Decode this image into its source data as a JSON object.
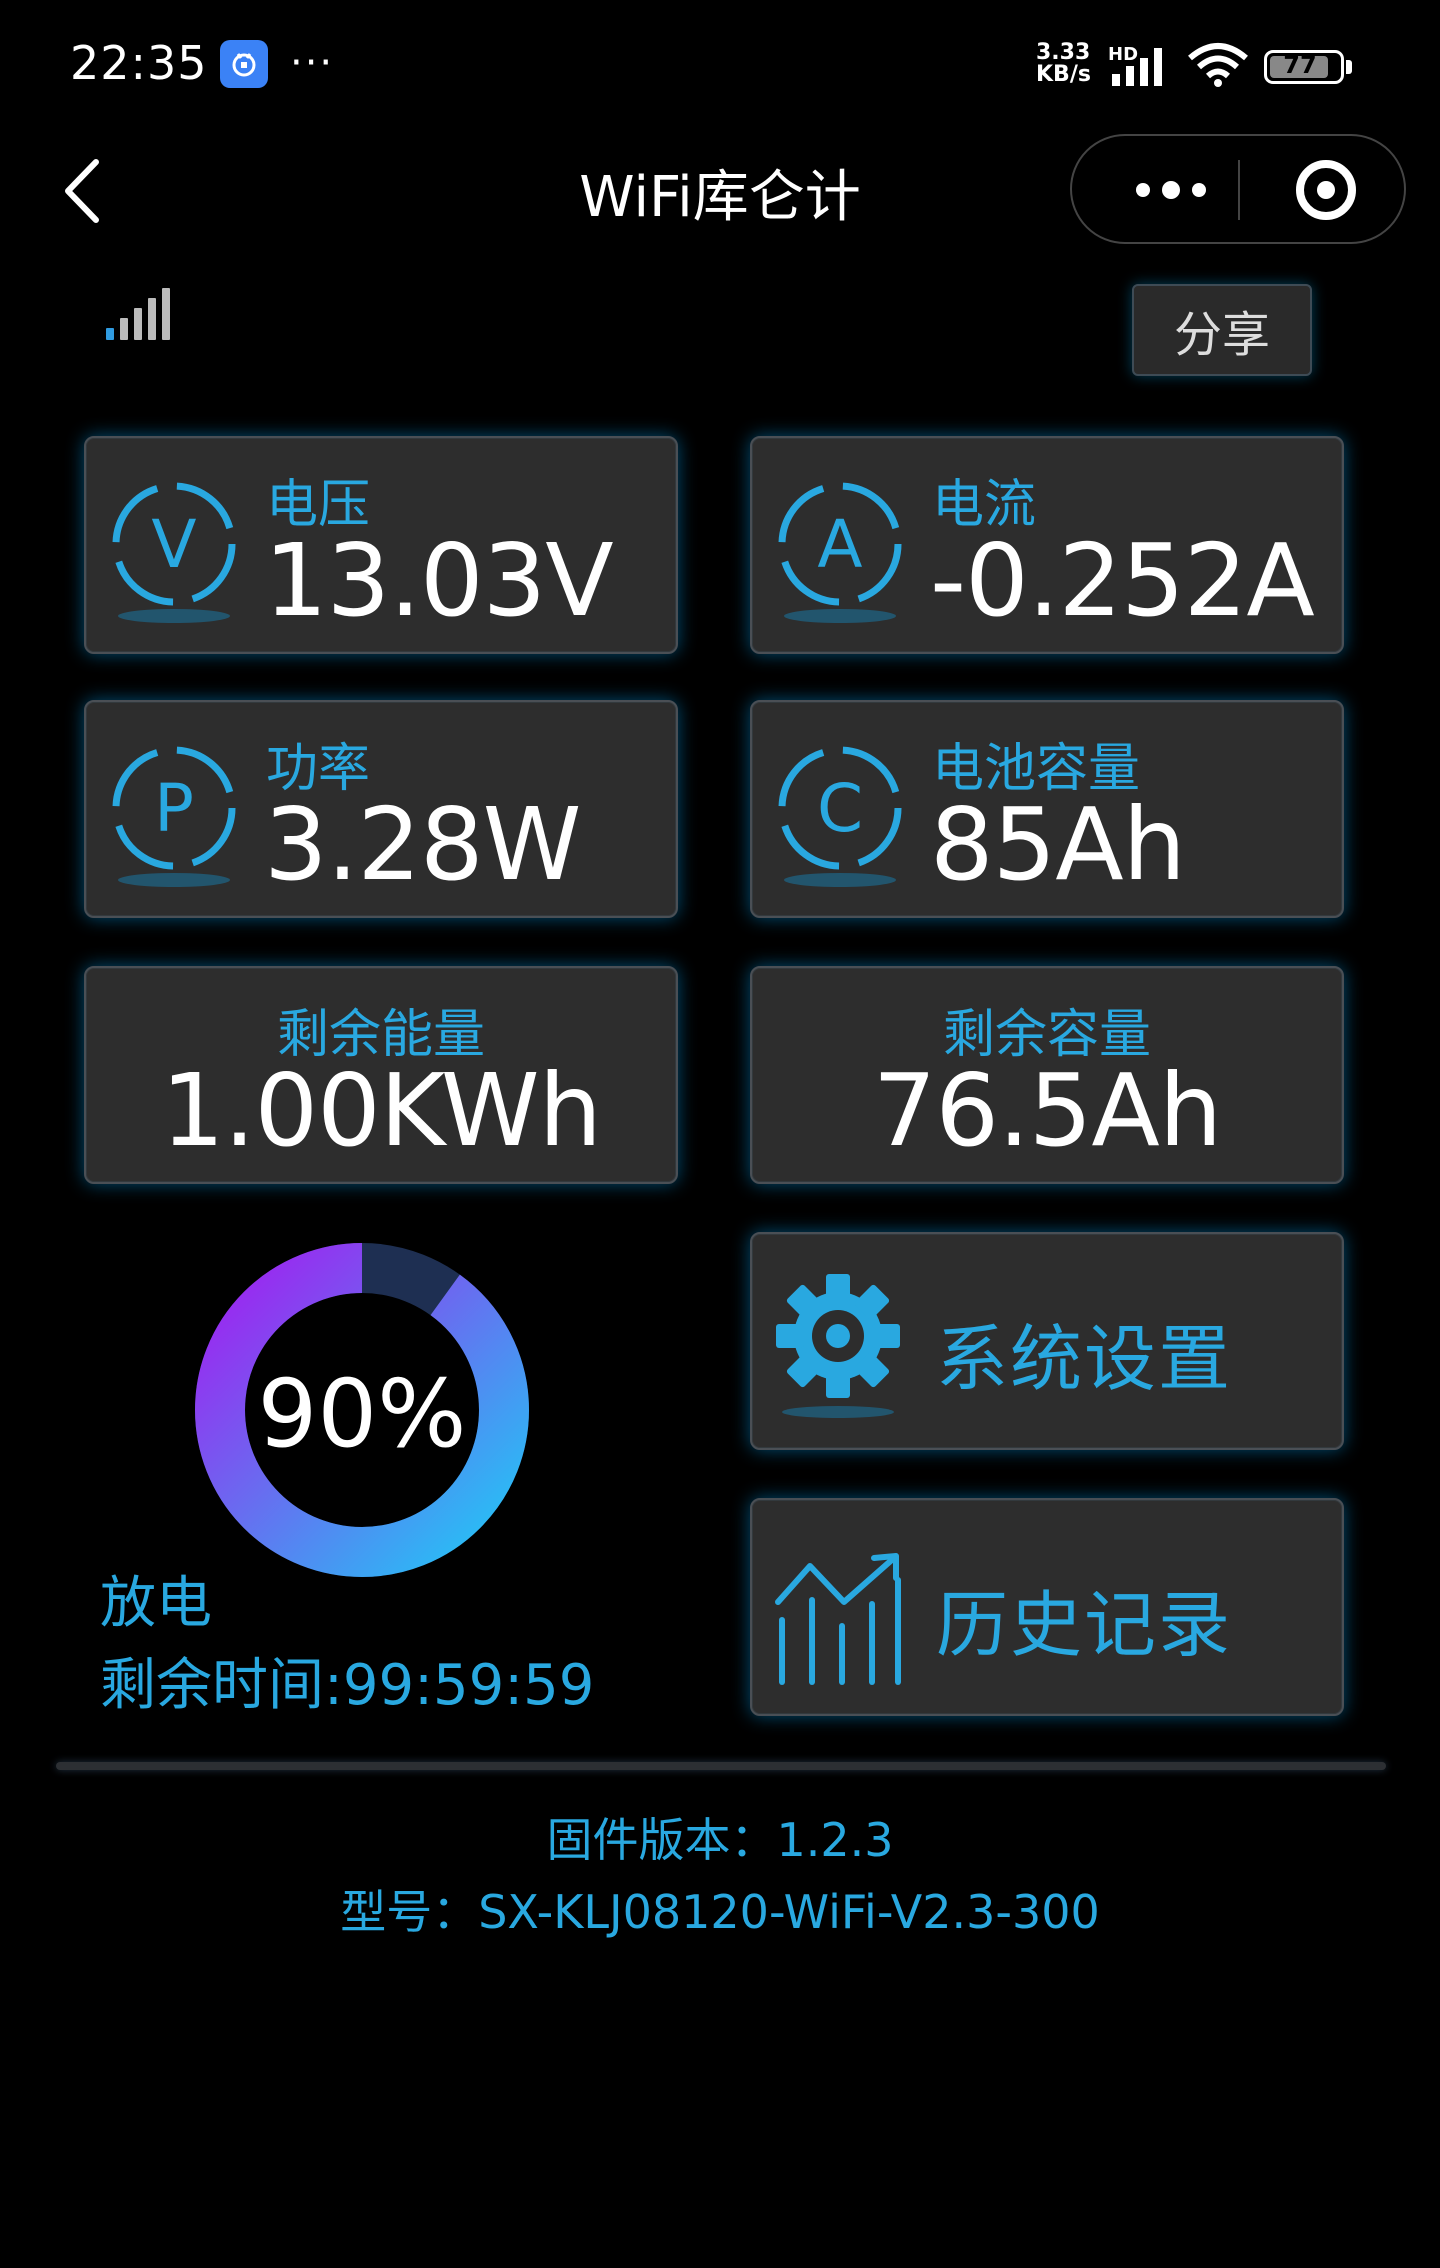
{
  "status_bar": {
    "time": "22:35",
    "more": "···",
    "net_speed_value": "3.33",
    "net_speed_unit": "KB/s",
    "hd": "HD",
    "battery": "77"
  },
  "nav": {
    "title": "WiFi库仑计"
  },
  "share_label": "分享",
  "cards": {
    "voltage": {
      "label": "电压",
      "value": "13.03V",
      "icon_letter": "V"
    },
    "current": {
      "label": "电流",
      "value": "-0.252A",
      "icon_letter": "A"
    },
    "power": {
      "label": "功率",
      "value": "3.28W",
      "icon_letter": "P"
    },
    "capacity": {
      "label": "电池容量",
      "value": "85Ah",
      "icon_letter": "C"
    },
    "remaining_energy": {
      "label": "剩余能量",
      "value": "1.00KWh"
    },
    "remaining_capacity": {
      "label": "剩余容量",
      "value": "76.5Ah"
    }
  },
  "actions": {
    "settings": {
      "label": "系统设置",
      "icon": "gear-icon"
    },
    "history": {
      "label": "历史记录",
      "icon": "chart-trend-icon"
    }
  },
  "soc": {
    "percent_text": "90%",
    "percent_value": 90,
    "state": "放电",
    "remaining_time": "剩余时间:99:59:59"
  },
  "footer": {
    "firmware": "固件版本：1.2.3",
    "model": "型号：SX-KLJ08120-WiFi-V2.3-300"
  },
  "colors": {
    "accent": "#29a8e0",
    "card_bg": "#2d2d2d",
    "donut_start": "#22c6f5",
    "donut_end": "#a020f0",
    "donut_track": "#1e2f52"
  }
}
